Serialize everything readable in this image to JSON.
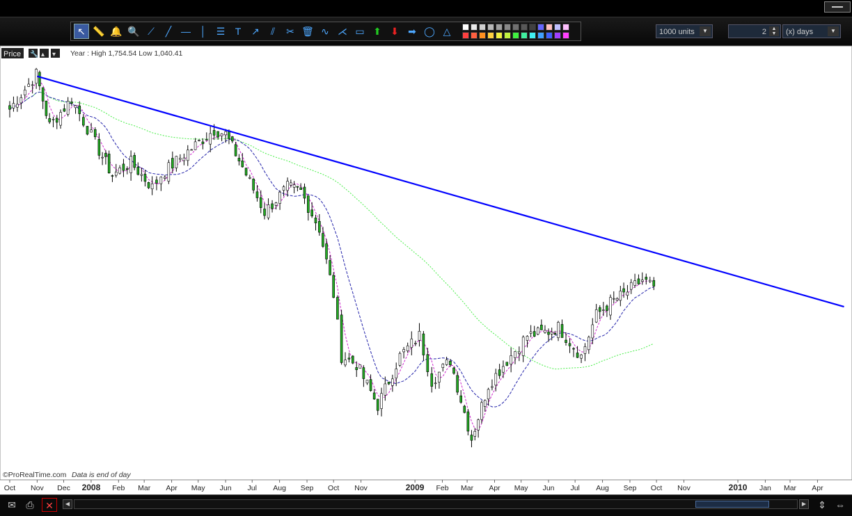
{
  "toolbar": {
    "units": "1000 units",
    "period_value": "2",
    "period_unit": "(x) days",
    "tools": [
      "pointer-icon",
      "ruler-icon",
      "alarm-icon",
      "zoom-icon",
      "segment-icon",
      "line-icon",
      "horizontal-line-icon",
      "vertical-line-icon",
      "fibonacci-icon",
      "text-icon",
      "trend-icon",
      "parallel-icon",
      "tools-icon",
      "trash-icon",
      "wave-icon",
      "fan-icon",
      "rectangle-icon",
      "up-arrow-icon",
      "down-arrow-icon",
      "right-arrow-icon",
      "ellipse-icon",
      "triangle-icon"
    ],
    "palette": [
      "#ffffff",
      "#e8e8e8",
      "#d0d0d0",
      "#b8b8b8",
      "#a0a0a0",
      "#888888",
      "#707070",
      "#585858",
      "#404040",
      "#6666ff",
      "#ffc0c0",
      "#c0c0ff",
      "#ffc0ff",
      "#ff4040",
      "#ff6040",
      "#ff9020",
      "#ffd040",
      "#f0f040",
      "#c0f040",
      "#40f040",
      "#40f0a0",
      "#40f0f0",
      "#40a0ff",
      "#4060ff",
      "#a040ff",
      "#ff40ff"
    ]
  },
  "chart_header": {
    "label": "Price",
    "info": "Year : High 1,754.54 Low 1,040.41"
  },
  "footer": {
    "credit": "©ProRealTime.com",
    "note": "Data is end of day"
  },
  "colors": {
    "background": "#ffffff",
    "trendline": "#0000ff",
    "ma_long": "#44ee44",
    "ma_medium": "#2222aa",
    "ma_short": "#cc22cc",
    "candle_up": "#ffffff",
    "candle_down": "#22aa22",
    "wick": "#000000"
  },
  "chart_data": {
    "type": "candlestick",
    "title": "",
    "x_axis_labels": [
      "Oct",
      "Nov",
      "Dec",
      "2008",
      "Feb",
      "Mar",
      "Apr",
      "May",
      "Jun",
      "Jul",
      "Aug",
      "Sep",
      "Oct",
      "Nov",
      "2009",
      "Feb",
      "Mar",
      "Apr",
      "May",
      "Jun",
      "Jul",
      "Aug",
      "Sep",
      "Oct",
      "Nov",
      "2010",
      "Jan",
      "Mar",
      "Apr"
    ],
    "year_high": 1754.54,
    "year_low": 1040.41,
    "trendline": {
      "from": [
        "2007-11-01",
        1560
      ],
      "to": [
        "2010-05-01",
        1000
      ]
    },
    "approx_close_path": [
      [
        "2007-10-01",
        1480
      ],
      [
        "2007-10-31",
        1565
      ],
      [
        "2007-11-15",
        1440
      ],
      [
        "2007-12-10",
        1505
      ],
      [
        "2008-01-10",
        1380
      ],
      [
        "2008-01-25",
        1320
      ],
      [
        "2008-02-15",
        1350
      ],
      [
        "2008-03-10",
        1290
      ],
      [
        "2008-03-20",
        1320
      ],
      [
        "2008-04-15",
        1370
      ],
      [
        "2008-05-19",
        1430
      ],
      [
        "2008-06-01",
        1420
      ],
      [
        "2008-06-20",
        1340
      ],
      [
        "2008-07-15",
        1230
      ],
      [
        "2008-08-10",
        1290
      ],
      [
        "2008-08-25",
        1280
      ],
      [
        "2008-09-15",
        1190
      ],
      [
        "2008-10-01",
        1030
      ],
      [
        "2008-10-10",
        880
      ],
      [
        "2008-10-27",
        860
      ],
      [
        "2008-11-20",
        760
      ],
      [
        "2008-12-15",
        880
      ],
      [
        "2009-01-06",
        930
      ],
      [
        "2009-01-20",
        820
      ],
      [
        "2009-02-10",
        870
      ],
      [
        "2009-03-06",
        680
      ],
      [
        "2009-03-25",
        810
      ],
      [
        "2009-04-15",
        870
      ],
      [
        "2009-05-08",
        930
      ],
      [
        "2009-06-01",
        940
      ],
      [
        "2009-06-12",
        950
      ],
      [
        "2009-07-08",
        880
      ],
      [
        "2009-07-25",
        980
      ],
      [
        "2009-08-10",
        1010
      ],
      [
        "2009-08-25",
        1030
      ],
      [
        "2009-09-15",
        1065
      ],
      [
        "2009-09-28",
        1050
      ]
    ],
    "moving_averages": [
      {
        "period": "long",
        "style": "dotted",
        "color": "#44ee44"
      },
      {
        "period": "medium",
        "style": "dashed",
        "color": "#2222aa"
      },
      {
        "period": "short",
        "style": "dashed",
        "color": "#cc22cc"
      }
    ]
  }
}
